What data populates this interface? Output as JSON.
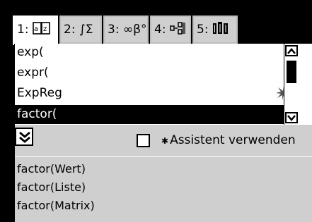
{
  "tabs": [
    {
      "label": "1:",
      "icon": "book-icon"
    },
    {
      "label": "2: ∫Σ",
      "icon": "integral-sum-icon"
    },
    {
      "label": "3: ∞β°",
      "icon": "symbols-icon"
    },
    {
      "label": "4:",
      "icon": "template-icon"
    },
    {
      "label": "5:",
      "icon": "library-icon"
    }
  ],
  "catalog": {
    "items": [
      "exp(",
      "expr(",
      "ExpReg",
      "factor("
    ],
    "selected": "factor("
  },
  "assistant": {
    "label": "Assistent verwenden",
    "checked": false
  },
  "syntax": [
    "factor(Wert)",
    "factor(Liste)",
    "factor(Matrix)"
  ]
}
